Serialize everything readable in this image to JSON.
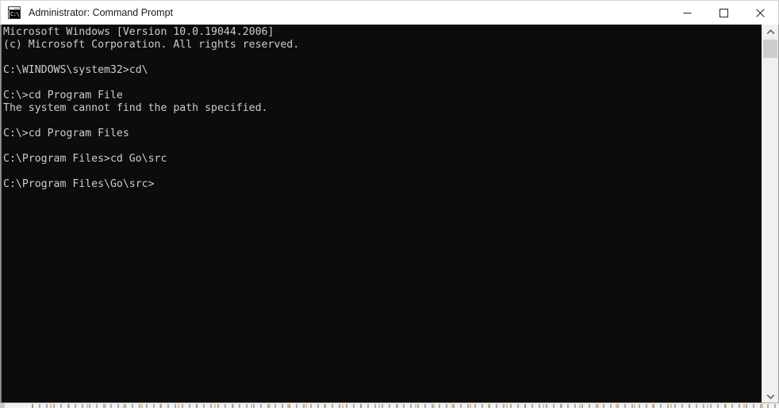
{
  "window": {
    "title": "Administrator: Command Prompt",
    "icon": "cmd-icon",
    "icon_glyph": "C:\\",
    "colors": {
      "titlebar_background": "#ffffff",
      "titlebar_text": "#1a1a1a",
      "console_background": "#0c0c0c",
      "console_text": "#cccccc",
      "scrollbar_track": "#f0f0f0",
      "scrollbar_thumb": "#cdcdcd",
      "window_border": "#9e9e9e"
    },
    "controls": [
      {
        "name": "minimize",
        "label": "Minimize",
        "glyph": "minimize-icon"
      },
      {
        "name": "maximize",
        "label": "Maximize",
        "glyph": "maximize-icon"
      },
      {
        "name": "close",
        "label": "Close",
        "glyph": "close-icon"
      }
    ]
  },
  "console": {
    "lines": [
      "Microsoft Windows [Version 10.0.19044.2006]",
      "(c) Microsoft Corporation. All rights reserved.",
      "",
      "C:\\WINDOWS\\system32>cd\\",
      "",
      "C:\\>cd Program File",
      "The system cannot find the path specified.",
      "",
      "C:\\>cd Program Files",
      "",
      "C:\\Program Files>cd Go\\src",
      "",
      "C:\\Program Files\\Go\\src>"
    ],
    "prompt": "C:\\Program Files\\Go\\src>",
    "current_directory": "C:\\Program Files\\Go\\src",
    "os_version": "10.0.19044.2006"
  },
  "scrollbar": {
    "up_arrow": "chevron-up-icon",
    "down_arrow": "chevron-down-icon",
    "thumb_position_percent": 0,
    "orientation": "vertical"
  }
}
